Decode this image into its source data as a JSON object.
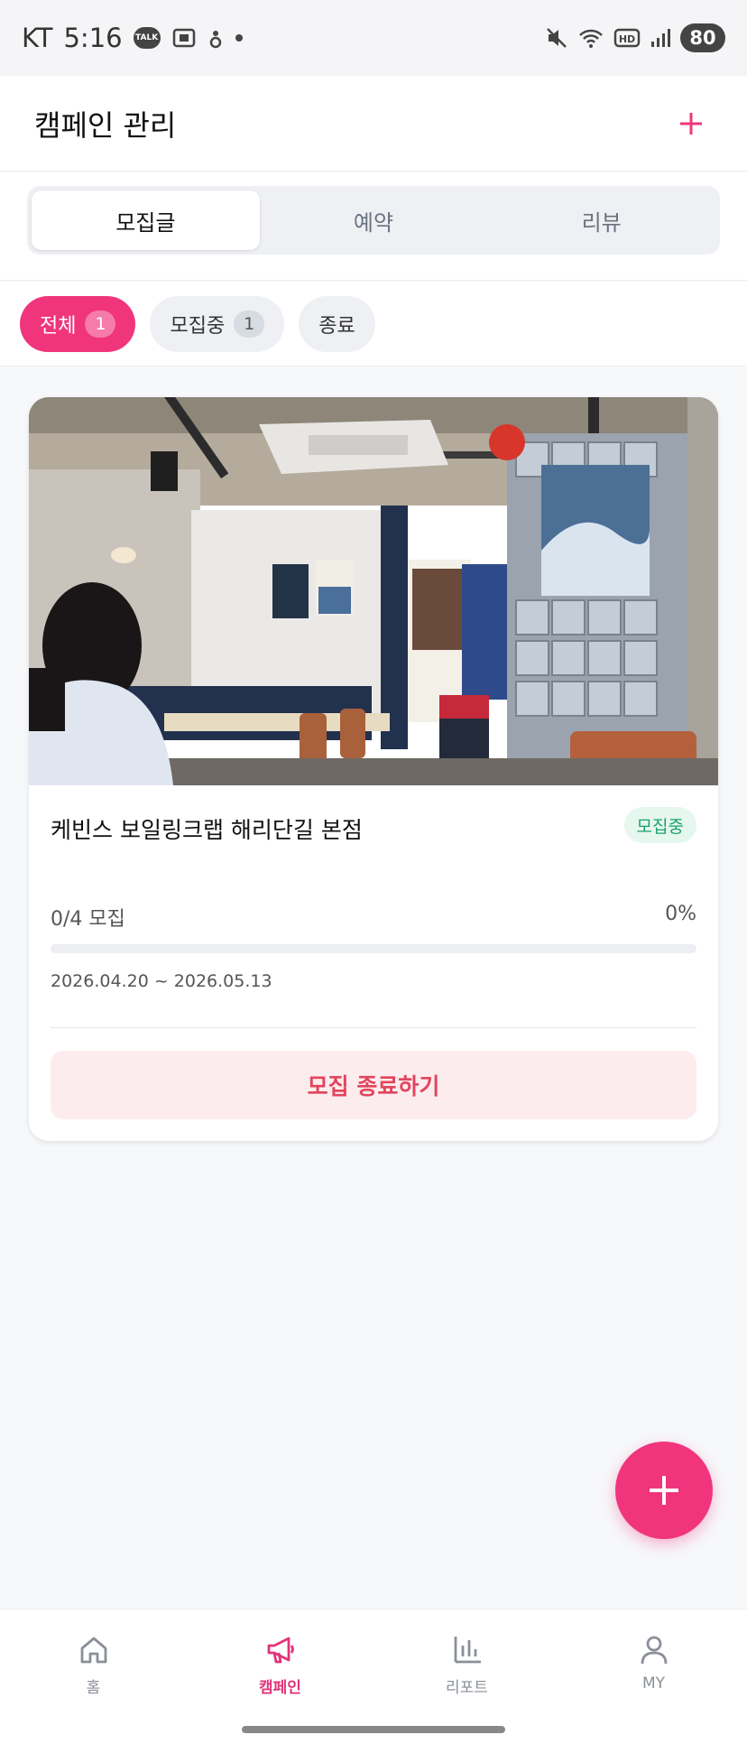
{
  "status_bar": {
    "carrier": "KT",
    "time": "5:16",
    "talk_icon_text": "TALK",
    "battery": "80"
  },
  "header": {
    "title": "캠페인 관리",
    "add_icon": "plus-icon"
  },
  "tabs": [
    {
      "label": "모집글",
      "active": true
    },
    {
      "label": "예약",
      "active": false
    },
    {
      "label": "리뷰",
      "active": false
    }
  ],
  "filters": [
    {
      "label": "전체",
      "count": "1",
      "active": true
    },
    {
      "label": "모집중",
      "count": "1",
      "active": false
    },
    {
      "label": "종료",
      "active": false
    }
  ],
  "campaign": {
    "title": "케빈스 보일링크랩 해리단길 본점",
    "status": "모집중",
    "progress_text": "0/4 모집",
    "progress_percent": "0%",
    "progress_value": 0,
    "date_range": "2026.04.20 ~ 2026.05.13",
    "end_button": "모집 종료하기",
    "photo_icon": "restaurant-interior-photo"
  },
  "fab_icon": "plus-icon",
  "bottom_nav": [
    {
      "label": "홈",
      "icon": "home-icon",
      "active": false
    },
    {
      "label": "캠페인",
      "icon": "megaphone-icon",
      "active": true
    },
    {
      "label": "리포트",
      "icon": "bar-chart-icon",
      "active": false
    },
    {
      "label": "MY",
      "icon": "user-icon",
      "active": false
    }
  ],
  "colors": {
    "accent": "#f0357d",
    "status_green": "#1aa36a",
    "end_button_text": "#e2455c"
  }
}
